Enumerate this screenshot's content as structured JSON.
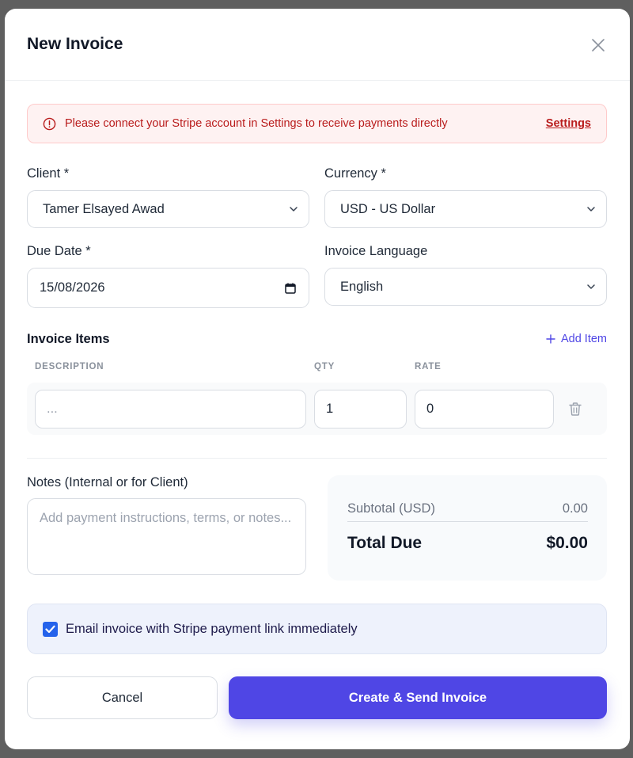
{
  "modal": {
    "title": "New Invoice"
  },
  "alert": {
    "message": "Please connect your Stripe account in Settings to receive payments directly",
    "link_label": "Settings"
  },
  "fields": {
    "client_label": "Client *",
    "client_value": "Tamer Elsayed Awad",
    "currency_label": "Currency *",
    "currency_value": "USD - US Dollar",
    "due_date_label": "Due Date *",
    "due_date_value": "15/08/2026",
    "language_label": "Invoice Language",
    "language_value": "English"
  },
  "items": {
    "section_title": "Invoice Items",
    "add_label": "Add Item",
    "columns": [
      "DESCRIPTION",
      "QTY",
      "RATE"
    ],
    "rows": [
      {
        "description_placeholder": "...",
        "qty": "1",
        "rate": "0"
      }
    ]
  },
  "notes": {
    "label": "Notes (Internal or for Client)",
    "placeholder": "Add payment instructions, terms, or notes..."
  },
  "summary": {
    "subtotal_label": "Subtotal (USD)",
    "subtotal_value": "0.00",
    "total_label": "Total Due",
    "total_value": "$0.00"
  },
  "email_option": {
    "label": "Email invoice with Stripe payment link immediately",
    "checked": true
  },
  "actions": {
    "cancel_label": "Cancel",
    "create_label": "Create & Send Invoice"
  },
  "colors": {
    "primary": "#4f46e5",
    "alert_text": "#b91c1c",
    "alert_bg": "#fef2f2",
    "checkbox": "#2563eb"
  },
  "icons": {
    "close": "close-icon",
    "alert": "alert-circle-icon",
    "chevron": "chevron-down-icon",
    "calendar": "calendar-icon",
    "plus": "plus-icon",
    "trash": "trash-icon",
    "check": "check-icon"
  }
}
